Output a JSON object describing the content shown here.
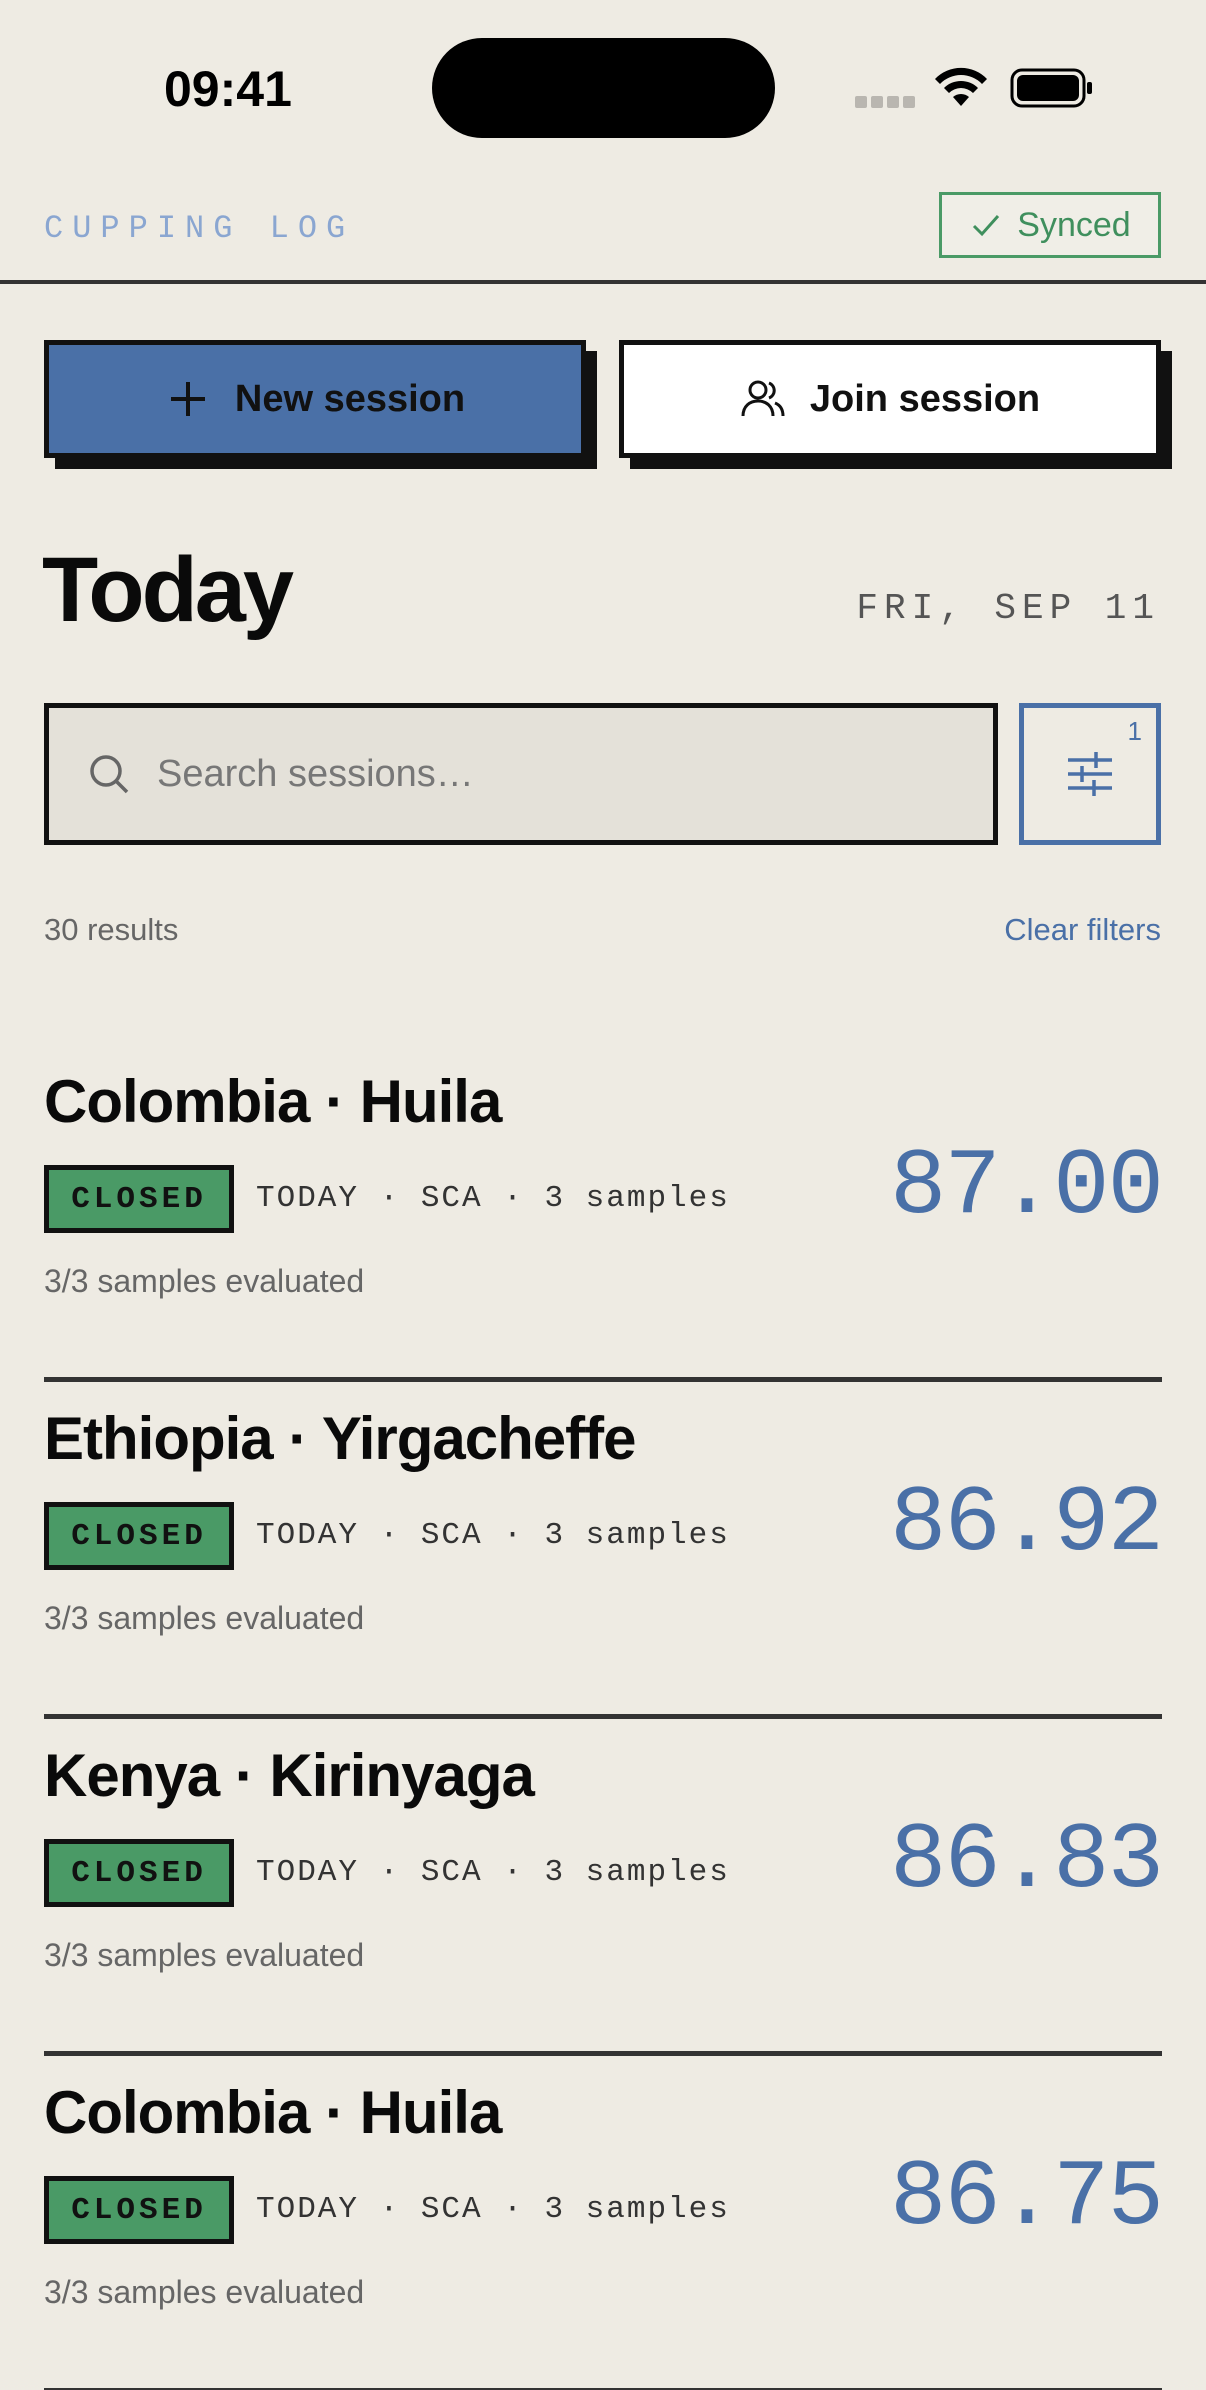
{
  "status_bar": {
    "time": "09:41"
  },
  "header": {
    "title": "CUPPING LOG",
    "sync_label": "Synced"
  },
  "actions": {
    "new_session": "New session",
    "join_session": "Join session"
  },
  "heading": {
    "title": "Today",
    "date": "FRI, SEP 11"
  },
  "search": {
    "placeholder": "Search sessions…",
    "value": "",
    "filter_count": "1"
  },
  "results": {
    "count_label": "30 results",
    "clear_label": "Clear filters"
  },
  "sessions": [
    {
      "name": "Colombia · Huila",
      "status": "CLOSED",
      "meta": "TODAY · SCA · 3 samples",
      "progress": "3/3 samples evaluated",
      "score": "87.00"
    },
    {
      "name": "Ethiopia · Yirgacheffe",
      "status": "CLOSED",
      "meta": "TODAY · SCA · 3 samples",
      "progress": "3/3 samples evaluated",
      "score": "86.92"
    },
    {
      "name": "Kenya · Kirinyaga",
      "status": "CLOSED",
      "meta": "TODAY · SCA · 3 samples",
      "progress": "3/3 samples evaluated",
      "score": "86.83"
    },
    {
      "name": "Colombia · Huila",
      "status": "CLOSED",
      "meta": "TODAY · SCA · 3 samples",
      "progress": "3/3 samples evaluated",
      "score": "86.75"
    }
  ],
  "colors": {
    "accent": "#4a70a7",
    "success": "#4a9a66",
    "background": "#eeebe3"
  },
  "icons": [
    "wifi-icon",
    "battery-icon",
    "check-icon",
    "plus-icon",
    "users-icon",
    "search-icon",
    "sliders-icon"
  ]
}
